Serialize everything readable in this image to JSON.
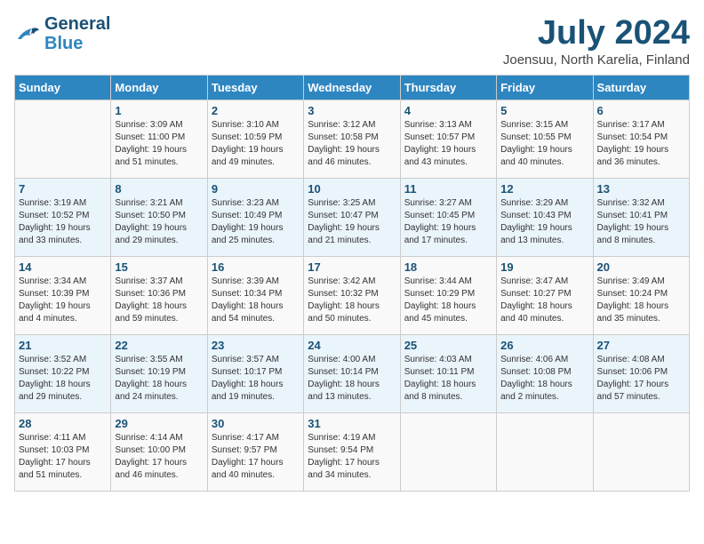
{
  "header": {
    "logo_line1": "General",
    "logo_line2": "Blue",
    "month_year": "July 2024",
    "location": "Joensuu, North Karelia, Finland"
  },
  "columns": [
    "Sunday",
    "Monday",
    "Tuesday",
    "Wednesday",
    "Thursday",
    "Friday",
    "Saturday"
  ],
  "weeks": [
    [
      {
        "day": "",
        "info": ""
      },
      {
        "day": "1",
        "info": "Sunrise: 3:09 AM\nSunset: 11:00 PM\nDaylight: 19 hours\nand 51 minutes."
      },
      {
        "day": "2",
        "info": "Sunrise: 3:10 AM\nSunset: 10:59 PM\nDaylight: 19 hours\nand 49 minutes."
      },
      {
        "day": "3",
        "info": "Sunrise: 3:12 AM\nSunset: 10:58 PM\nDaylight: 19 hours\nand 46 minutes."
      },
      {
        "day": "4",
        "info": "Sunrise: 3:13 AM\nSunset: 10:57 PM\nDaylight: 19 hours\nand 43 minutes."
      },
      {
        "day": "5",
        "info": "Sunrise: 3:15 AM\nSunset: 10:55 PM\nDaylight: 19 hours\nand 40 minutes."
      },
      {
        "day": "6",
        "info": "Sunrise: 3:17 AM\nSunset: 10:54 PM\nDaylight: 19 hours\nand 36 minutes."
      }
    ],
    [
      {
        "day": "7",
        "info": "Sunrise: 3:19 AM\nSunset: 10:52 PM\nDaylight: 19 hours\nand 33 minutes."
      },
      {
        "day": "8",
        "info": "Sunrise: 3:21 AM\nSunset: 10:50 PM\nDaylight: 19 hours\nand 29 minutes."
      },
      {
        "day": "9",
        "info": "Sunrise: 3:23 AM\nSunset: 10:49 PM\nDaylight: 19 hours\nand 25 minutes."
      },
      {
        "day": "10",
        "info": "Sunrise: 3:25 AM\nSunset: 10:47 PM\nDaylight: 19 hours\nand 21 minutes."
      },
      {
        "day": "11",
        "info": "Sunrise: 3:27 AM\nSunset: 10:45 PM\nDaylight: 19 hours\nand 17 minutes."
      },
      {
        "day": "12",
        "info": "Sunrise: 3:29 AM\nSunset: 10:43 PM\nDaylight: 19 hours\nand 13 minutes."
      },
      {
        "day": "13",
        "info": "Sunrise: 3:32 AM\nSunset: 10:41 PM\nDaylight: 19 hours\nand 8 minutes."
      }
    ],
    [
      {
        "day": "14",
        "info": "Sunrise: 3:34 AM\nSunset: 10:39 PM\nDaylight: 19 hours\nand 4 minutes."
      },
      {
        "day": "15",
        "info": "Sunrise: 3:37 AM\nSunset: 10:36 PM\nDaylight: 18 hours\nand 59 minutes."
      },
      {
        "day": "16",
        "info": "Sunrise: 3:39 AM\nSunset: 10:34 PM\nDaylight: 18 hours\nand 54 minutes."
      },
      {
        "day": "17",
        "info": "Sunrise: 3:42 AM\nSunset: 10:32 PM\nDaylight: 18 hours\nand 50 minutes."
      },
      {
        "day": "18",
        "info": "Sunrise: 3:44 AM\nSunset: 10:29 PM\nDaylight: 18 hours\nand 45 minutes."
      },
      {
        "day": "19",
        "info": "Sunrise: 3:47 AM\nSunset: 10:27 PM\nDaylight: 18 hours\nand 40 minutes."
      },
      {
        "day": "20",
        "info": "Sunrise: 3:49 AM\nSunset: 10:24 PM\nDaylight: 18 hours\nand 35 minutes."
      }
    ],
    [
      {
        "day": "21",
        "info": "Sunrise: 3:52 AM\nSunset: 10:22 PM\nDaylight: 18 hours\nand 29 minutes."
      },
      {
        "day": "22",
        "info": "Sunrise: 3:55 AM\nSunset: 10:19 PM\nDaylight: 18 hours\nand 24 minutes."
      },
      {
        "day": "23",
        "info": "Sunrise: 3:57 AM\nSunset: 10:17 PM\nDaylight: 18 hours\nand 19 minutes."
      },
      {
        "day": "24",
        "info": "Sunrise: 4:00 AM\nSunset: 10:14 PM\nDaylight: 18 hours\nand 13 minutes."
      },
      {
        "day": "25",
        "info": "Sunrise: 4:03 AM\nSunset: 10:11 PM\nDaylight: 18 hours\nand 8 minutes."
      },
      {
        "day": "26",
        "info": "Sunrise: 4:06 AM\nSunset: 10:08 PM\nDaylight: 18 hours\nand 2 minutes."
      },
      {
        "day": "27",
        "info": "Sunrise: 4:08 AM\nSunset: 10:06 PM\nDaylight: 17 hours\nand 57 minutes."
      }
    ],
    [
      {
        "day": "28",
        "info": "Sunrise: 4:11 AM\nSunset: 10:03 PM\nDaylight: 17 hours\nand 51 minutes."
      },
      {
        "day": "29",
        "info": "Sunrise: 4:14 AM\nSunset: 10:00 PM\nDaylight: 17 hours\nand 46 minutes."
      },
      {
        "day": "30",
        "info": "Sunrise: 4:17 AM\nSunset: 9:57 PM\nDaylight: 17 hours\nand 40 minutes."
      },
      {
        "day": "31",
        "info": "Sunrise: 4:19 AM\nSunset: 9:54 PM\nDaylight: 17 hours\nand 34 minutes."
      },
      {
        "day": "",
        "info": ""
      },
      {
        "day": "",
        "info": ""
      },
      {
        "day": "",
        "info": ""
      }
    ]
  ]
}
